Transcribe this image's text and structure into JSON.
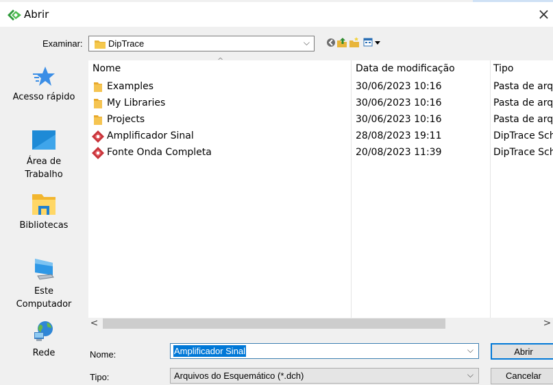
{
  "window": {
    "title": "Abrir",
    "close_glyph": "×"
  },
  "toolbar": {
    "look_in_label": "Examinar:",
    "look_in_value": "DipTrace",
    "icons": [
      "back-icon",
      "up-folder-icon",
      "new-folder-icon",
      "view-menu-icon"
    ]
  },
  "places": [
    {
      "label": "Acesso rápido",
      "icon": "star-icon"
    },
    {
      "label": "Área de\nTrabalho",
      "icon": "desktop-icon"
    },
    {
      "label": "Bibliotecas",
      "icon": "libraries-icon"
    },
    {
      "label": "Este\nComputador",
      "icon": "computer-icon"
    },
    {
      "label": "Rede",
      "icon": "network-globe-icon"
    }
  ],
  "columns": {
    "name": "Nome",
    "date": "Data de modificação",
    "type": "Tipo"
  },
  "files": [
    {
      "name": "Examples",
      "date": "30/06/2023 10:16",
      "type": "Pasta de arquivos",
      "icon": "folder-icon"
    },
    {
      "name": "My Libraries",
      "date": "30/06/2023 10:16",
      "type": "Pasta de arquivos",
      "icon": "folder-icon"
    },
    {
      "name": "Projects",
      "date": "30/06/2023 10:16",
      "type": "Pasta de arquivos",
      "icon": "folder-icon"
    },
    {
      "name": "Amplificador Sinal",
      "date": "28/08/2023 19:11",
      "type": "DipTrace Schematic",
      "icon": "diptrace-schematic-icon"
    },
    {
      "name": "Fonte Onda Completa",
      "date": "20/08/2023 11:39",
      "type": "DipTrace Schematic",
      "icon": "diptrace-schematic-icon"
    }
  ],
  "footer": {
    "name_label": "Nome:",
    "name_value": "Amplificador Sinal",
    "type_label": "Tipo:",
    "type_value": "Arquivos do Esquemático (*.dch)",
    "open_button": "Abrir",
    "cancel_button": "Cancelar"
  },
  "colors": {
    "selection": "#0078d7",
    "folder": "#e8b53a",
    "diptrace_red": "#c8343a"
  }
}
